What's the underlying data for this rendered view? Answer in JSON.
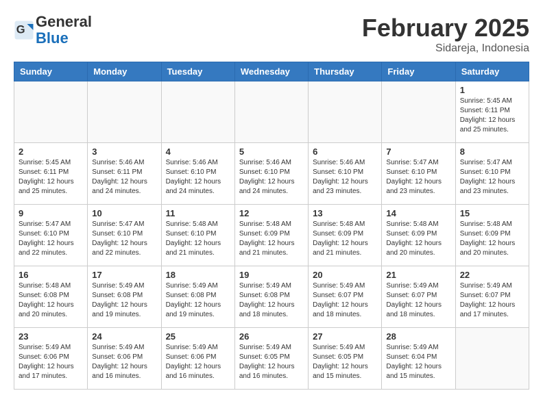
{
  "header": {
    "logo_general": "General",
    "logo_blue": "Blue",
    "month": "February 2025",
    "location": "Sidareja, Indonesia"
  },
  "weekdays": [
    "Sunday",
    "Monday",
    "Tuesday",
    "Wednesday",
    "Thursday",
    "Friday",
    "Saturday"
  ],
  "weeks": [
    [
      {
        "day": "",
        "info": ""
      },
      {
        "day": "",
        "info": ""
      },
      {
        "day": "",
        "info": ""
      },
      {
        "day": "",
        "info": ""
      },
      {
        "day": "",
        "info": ""
      },
      {
        "day": "",
        "info": ""
      },
      {
        "day": "1",
        "info": "Sunrise: 5:45 AM\nSunset: 6:11 PM\nDaylight: 12 hours\nand 25 minutes."
      }
    ],
    [
      {
        "day": "2",
        "info": "Sunrise: 5:45 AM\nSunset: 6:11 PM\nDaylight: 12 hours\nand 25 minutes."
      },
      {
        "day": "3",
        "info": "Sunrise: 5:46 AM\nSunset: 6:11 PM\nDaylight: 12 hours\nand 24 minutes."
      },
      {
        "day": "4",
        "info": "Sunrise: 5:46 AM\nSunset: 6:10 PM\nDaylight: 12 hours\nand 24 minutes."
      },
      {
        "day": "5",
        "info": "Sunrise: 5:46 AM\nSunset: 6:10 PM\nDaylight: 12 hours\nand 24 minutes."
      },
      {
        "day": "6",
        "info": "Sunrise: 5:46 AM\nSunset: 6:10 PM\nDaylight: 12 hours\nand 23 minutes."
      },
      {
        "day": "7",
        "info": "Sunrise: 5:47 AM\nSunset: 6:10 PM\nDaylight: 12 hours\nand 23 minutes."
      },
      {
        "day": "8",
        "info": "Sunrise: 5:47 AM\nSunset: 6:10 PM\nDaylight: 12 hours\nand 23 minutes."
      }
    ],
    [
      {
        "day": "9",
        "info": "Sunrise: 5:47 AM\nSunset: 6:10 PM\nDaylight: 12 hours\nand 22 minutes."
      },
      {
        "day": "10",
        "info": "Sunrise: 5:47 AM\nSunset: 6:10 PM\nDaylight: 12 hours\nand 22 minutes."
      },
      {
        "day": "11",
        "info": "Sunrise: 5:48 AM\nSunset: 6:10 PM\nDaylight: 12 hours\nand 21 minutes."
      },
      {
        "day": "12",
        "info": "Sunrise: 5:48 AM\nSunset: 6:09 PM\nDaylight: 12 hours\nand 21 minutes."
      },
      {
        "day": "13",
        "info": "Sunrise: 5:48 AM\nSunset: 6:09 PM\nDaylight: 12 hours\nand 21 minutes."
      },
      {
        "day": "14",
        "info": "Sunrise: 5:48 AM\nSunset: 6:09 PM\nDaylight: 12 hours\nand 20 minutes."
      },
      {
        "day": "15",
        "info": "Sunrise: 5:48 AM\nSunset: 6:09 PM\nDaylight: 12 hours\nand 20 minutes."
      }
    ],
    [
      {
        "day": "16",
        "info": "Sunrise: 5:48 AM\nSunset: 6:08 PM\nDaylight: 12 hours\nand 20 minutes."
      },
      {
        "day": "17",
        "info": "Sunrise: 5:49 AM\nSunset: 6:08 PM\nDaylight: 12 hours\nand 19 minutes."
      },
      {
        "day": "18",
        "info": "Sunrise: 5:49 AM\nSunset: 6:08 PM\nDaylight: 12 hours\nand 19 minutes."
      },
      {
        "day": "19",
        "info": "Sunrise: 5:49 AM\nSunset: 6:08 PM\nDaylight: 12 hours\nand 18 minutes."
      },
      {
        "day": "20",
        "info": "Sunrise: 5:49 AM\nSunset: 6:07 PM\nDaylight: 12 hours\nand 18 minutes."
      },
      {
        "day": "21",
        "info": "Sunrise: 5:49 AM\nSunset: 6:07 PM\nDaylight: 12 hours\nand 18 minutes."
      },
      {
        "day": "22",
        "info": "Sunrise: 5:49 AM\nSunset: 6:07 PM\nDaylight: 12 hours\nand 17 minutes."
      }
    ],
    [
      {
        "day": "23",
        "info": "Sunrise: 5:49 AM\nSunset: 6:06 PM\nDaylight: 12 hours\nand 17 minutes."
      },
      {
        "day": "24",
        "info": "Sunrise: 5:49 AM\nSunset: 6:06 PM\nDaylight: 12 hours\nand 16 minutes."
      },
      {
        "day": "25",
        "info": "Sunrise: 5:49 AM\nSunset: 6:06 PM\nDaylight: 12 hours\nand 16 minutes."
      },
      {
        "day": "26",
        "info": "Sunrise: 5:49 AM\nSunset: 6:05 PM\nDaylight: 12 hours\nand 16 minutes."
      },
      {
        "day": "27",
        "info": "Sunrise: 5:49 AM\nSunset: 6:05 PM\nDaylight: 12 hours\nand 15 minutes."
      },
      {
        "day": "28",
        "info": "Sunrise: 5:49 AM\nSunset: 6:04 PM\nDaylight: 12 hours\nand 15 minutes."
      },
      {
        "day": "",
        "info": ""
      }
    ]
  ]
}
